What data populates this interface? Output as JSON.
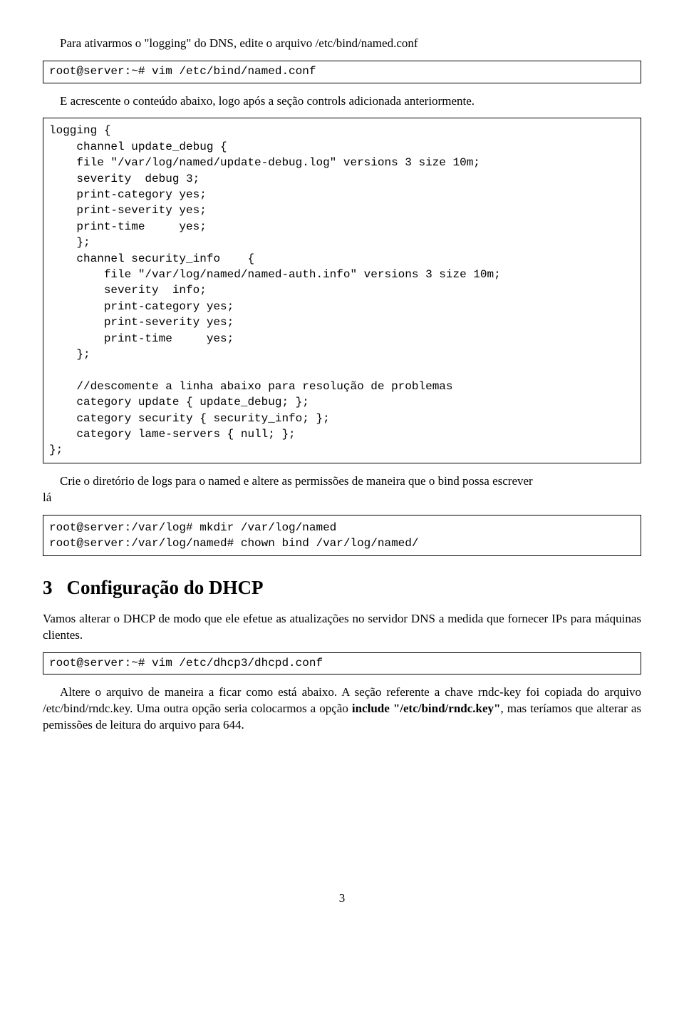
{
  "p1": "Para ativarmos o \"logging\" do DNS, edite o arquivo /etc/bind/named.conf",
  "code1": "root@server:~# vim /etc/bind/named.conf",
  "p2": "E acrescente o conteúdo abaixo, logo após a seção controls adicionada anteriormente.",
  "code2": "logging {\n    channel update_debug {\n    file \"/var/log/named/update-debug.log\" versions 3 size 10m;\n    severity  debug 3;\n    print-category yes;\n    print-severity yes;\n    print-time     yes;\n    };\n    channel security_info    {\n        file \"/var/log/named/named-auth.info\" versions 3 size 10m;\n        severity  info;\n        print-category yes;\n        print-severity yes;\n        print-time     yes;\n    };\n\n    //descomente a linha abaixo para resolução de problemas\n    category update { update_debug; };\n    category security { security_info; };\n    category lame-servers { null; };\n};",
  "p3_lead": "lá",
  "p3_body": "Crie o diretório de logs para o named e altere as permissões de maneira que o bind possa escrever",
  "code3": "root@server:/var/log# mkdir /var/log/named\nroot@server:/var/log/named# chown bind /var/log/named/",
  "sec3_num": "3",
  "sec3_title": "Configuração do DHCP",
  "p4": "Vamos alterar o DHCP de modo que ele efetue as atualizações no servidor DNS a medida que fornecer IPs para máquinas clientes.",
  "code4": "root@server:~# vim /etc/dhcp3/dhcpd.conf",
  "p5a": "Altere o arquivo de maneira a ficar como está abaixo. A seção referente a chave rndc-key foi copiada do arquivo /etc/bind/rndc.key. Uma outra opção seria colocarmos a opção ",
  "p5b": "include \"/etc/bind/rndc.key\"",
  "p5c": ", mas teríamos que alterar as pemissões de leitura do arquivo para 644.",
  "pagenum": "3"
}
